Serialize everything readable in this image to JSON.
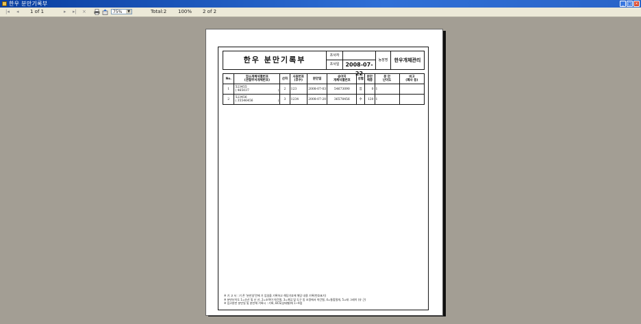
{
  "window": {
    "title": "한우 분만기록부"
  },
  "toolbar": {
    "nav_first": "|◂",
    "nav_prev": "◂",
    "page_of": "1 of 1",
    "nav_next": "▸",
    "nav_last": "▸|",
    "stop": "×",
    "zoom_value": "75%",
    "total": "Total:2",
    "percent": "100%",
    "page_count": "2 of 2"
  },
  "report": {
    "title": "한우  분만기록부",
    "survey_label_1": "조사자",
    "survey_label_2": "조사일",
    "survey_date": "2008-07-22",
    "farm_label": "농장명",
    "farm_name": "한우개체관리",
    "columns": [
      "No.",
      "암소개체식별번호\n(관할부서개체번호)",
      "산차",
      "사원번호\n(후수)",
      "분만일",
      "송아지\n개체식별번호",
      "성별",
      "분만\n체중",
      "분 만\n난이도",
      "비고\n(폐사 등)"
    ],
    "rows": [
      {
        "no": "1",
        "cow_id": "523455",
        "cow_sub": "( 465037",
        "cow_close": ")",
        "parity": "2",
        "sire": "123",
        "date": "2008-07-03",
        "calf_id": "54673090",
        "sex": "암",
        "weight": "0",
        "difficulty": "1",
        "note": ""
      },
      {
        "no": "2",
        "cow_id": "523456",
        "cow_sub": "( 35546456",
        "cow_close": ")",
        "parity": "3",
        "sire": "1234",
        "date": "2008-07-20",
        "calf_id": "36578456",
        "sex": "수",
        "weight": "120",
        "difficulty": "1",
        "note": ""
      }
    ],
    "notes": [
      "※ 기 고 서 : 기 존 '분만일'란에 기 입일을 기록하고 해당기호에 해당 내용 기록(번호표기)",
      "※ 분만난이도 1=순산 및 난 산, 2=조력이 약간필, 3=개입 및 도구 동 조정에서 약간필, 4=통합절개, 5=태 그레이 (유 근)",
      "※ 입고분만 분만일 및 분만체 기록시 : 기록, BCS(상태별)에 1~9점"
    ]
  }
}
